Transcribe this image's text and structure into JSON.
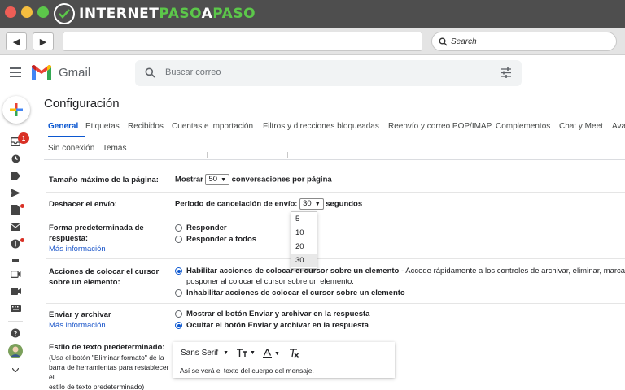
{
  "browser": {
    "brand_prefix": "INTERNET",
    "brand_accent": "PASO",
    "brand_mid": "A",
    "brand_suffix": "PASO",
    "search_placeholder": "Search"
  },
  "gmail": {
    "app_name": "Gmail",
    "search_placeholder": "Buscar correo",
    "inbox_badge": "1"
  },
  "settings": {
    "title": "Configuración",
    "tabs": [
      "General",
      "Etiquetas",
      "Recibidos",
      "Cuentas e importación",
      "Filtros y direcciones bloqueadas",
      "Reenvío y correo POP/IMAP",
      "Complementos",
      "Chat y Meet",
      "Ava"
    ],
    "tabs_row2": [
      "Sin conexión",
      "Temas"
    ],
    "page_size": {
      "label": "Tamaño máximo de la página:",
      "prefix": "Mostrar",
      "value": "50",
      "suffix": "conversaciones por página"
    },
    "undo_send": {
      "label": "Deshacer el envío:",
      "prefix": "Periodo de cancelación de envío:",
      "value": "30",
      "suffix": "segundos",
      "options": [
        "5",
        "10",
        "20",
        "30"
      ]
    },
    "reply_default": {
      "label": "Forma predeterminada de respuesta:",
      "link": "Más información",
      "options": [
        "Responder",
        "Responder a todos"
      ]
    },
    "hover": {
      "label": "Acciones de colocar el cursor sobre un elemento:",
      "opt1": "Habilitar acciones de colocar el cursor sobre un elemento",
      "opt1_desc": " - Accede rápidamente a los controles de archivar, eliminar, marcar co",
      "opt1_desc2": "posponer al colocar el cursor sobre un elemento.",
      "opt2": "Inhabilitar acciones de colocar el cursor sobre un elemento"
    },
    "send_archive": {
      "label": "Enviar y archivar",
      "link": "Más información",
      "opt1": "Mostrar el botón Enviar y archivar en la respuesta",
      "opt2": "Ocultar el botón Enviar y archivar en la respuesta"
    },
    "text_style": {
      "label": "Estilo de texto predeterminado:",
      "desc1": "(Usa el botón \"Eliminar formato\" de la",
      "desc2": "barra de herramientas para restablecer el",
      "desc3": "estilo de texto predeterminado)",
      "font": "Sans Serif",
      "preview": "Así se verá el texto del cuerpo del mensaje."
    }
  },
  "colors": {
    "accent": "#0b57d0",
    "link": "#1a55c9",
    "badge": "#d93025",
    "chrome_dark": "#4e4e4e",
    "brand_green": "#5cc74a"
  },
  "icons": [
    "compose-icon",
    "inbox-icon",
    "clock-icon",
    "label-icon",
    "send-icon",
    "draft-icon",
    "mail-icon",
    "spam-icon",
    "video-icon",
    "keyboard-icon",
    "help-icon",
    "avatar"
  ]
}
